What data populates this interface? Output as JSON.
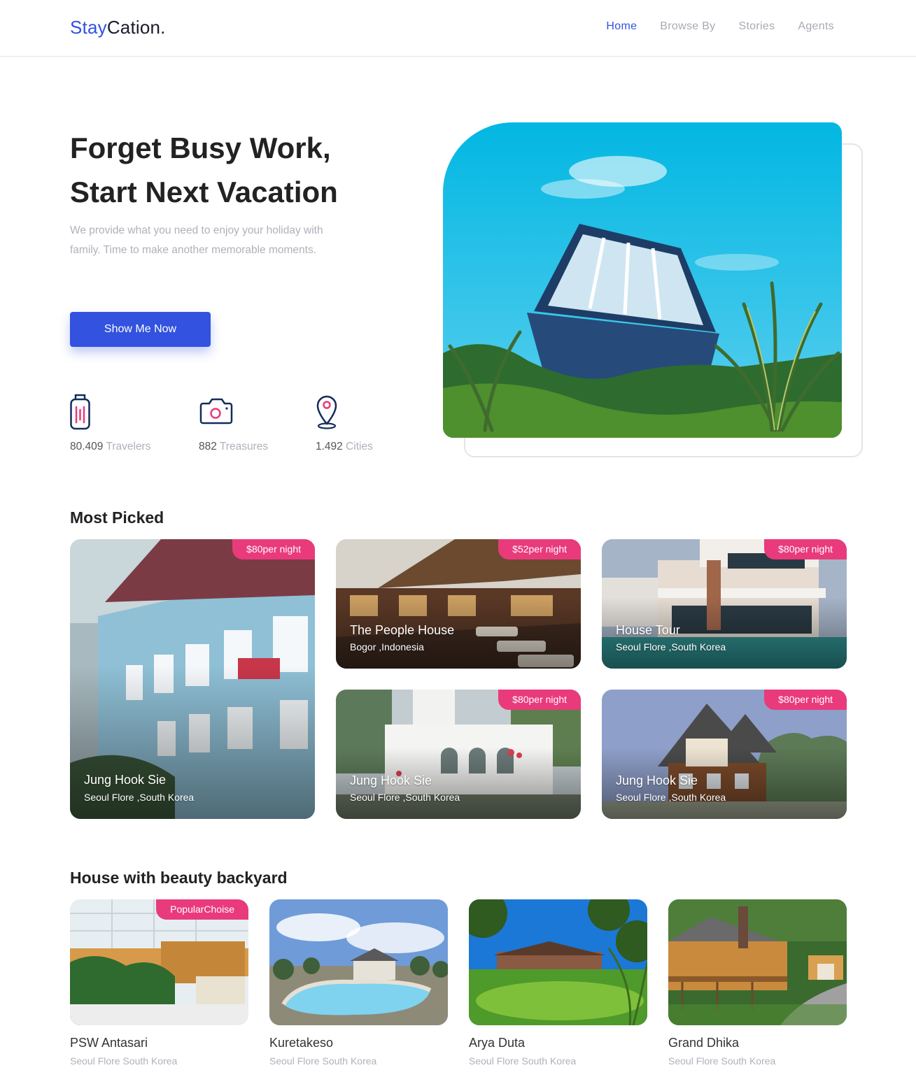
{
  "brand": {
    "part1": "Stay",
    "part2": "Cation."
  },
  "nav": [
    {
      "label": "Home",
      "active": true
    },
    {
      "label": "Browse By"
    },
    {
      "label": "Stories"
    },
    {
      "label": "Agents"
    }
  ],
  "hero": {
    "title_line1": "Forget Busy Work,",
    "title_line2": "Start Next Vacation",
    "description": "We provide what you need to enjoy your holiday with family. Time to make another memorable moments.",
    "button": "Show Me Now",
    "stats": [
      {
        "value": "80.409",
        "unit": "Travelers",
        "icon": "luggage-icon"
      },
      {
        "value": "882",
        "unit": "Treasures",
        "icon": "camera-icon"
      },
      {
        "value": "1.492",
        "unit": "Cities",
        "icon": "location-pin-icon"
      }
    ]
  },
  "most_picked": {
    "title": "Most Picked",
    "items": [
      {
        "price": "$80per night",
        "name": "Jung Hook Sie",
        "location": "Seoul Flore ,South Korea"
      },
      {
        "price": "$52per night",
        "name": "The People House",
        "location": "Bogor ,Indonesia"
      },
      {
        "price": "$80per night",
        "name": "House Tour",
        "location": "Seoul Flore ,South Korea"
      },
      {
        "price": "$80per night",
        "name": "Jung Hook Sie",
        "location": "Seoul Flore ,South Korea"
      },
      {
        "price": "$80per night",
        "name": "Jung Hook Sie",
        "location": "Seoul Flore ,South Korea"
      }
    ]
  },
  "backyard": {
    "title": "House with beauty backyard",
    "badge": "PopularChoise",
    "items": [
      {
        "name": "PSW Antasari",
        "location": "Seoul Flore South Korea"
      },
      {
        "name": "Kuretakeso",
        "location": "Seoul Flore South Korea"
      },
      {
        "name": "Arya Duta",
        "location": "Seoul Flore South Korea"
      },
      {
        "name": "Grand Dhika",
        "location": "Seoul Flore South Korea"
      }
    ]
  },
  "colors": {
    "primary": "#3252DF",
    "accent": "#E93A7C",
    "muted": "#B0B0BB",
    "heading": "#222222"
  }
}
